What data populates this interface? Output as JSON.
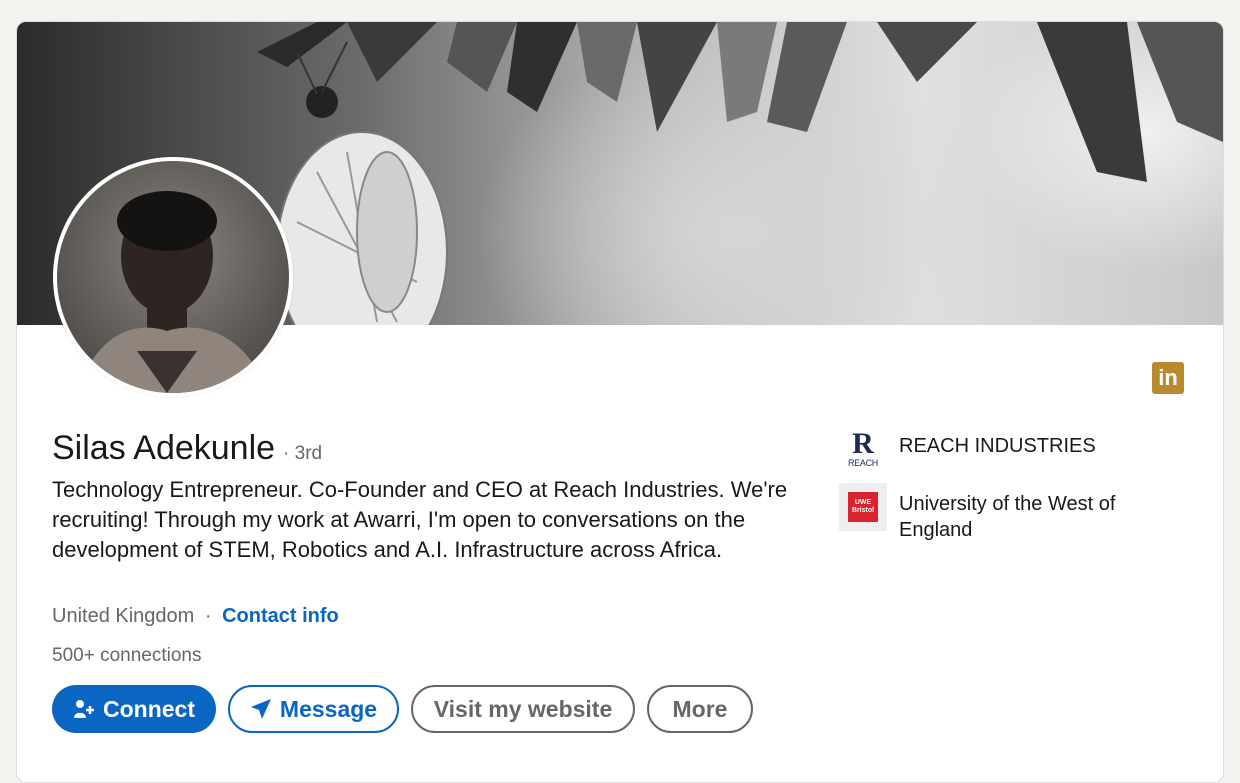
{
  "profile": {
    "name": "Silas Adekunle",
    "degree": "· 3rd",
    "headline": "Technology Entrepreneur. Co-Founder and CEO at Reach Industries. We're recruiting! Through my work at Awarri, I'm open to conversations on the development of STEM, Robotics and A.I. Infrastructure across Africa.",
    "location": "United Kingdom",
    "separator": "·",
    "contact_info": "Contact info",
    "connections": "500+ connections"
  },
  "actions": {
    "connect": "Connect",
    "message": "Message",
    "website": "Visit my website",
    "more": "More"
  },
  "sidebar": {
    "items": [
      {
        "label": "REACH INDUSTRIES",
        "logo_icon": "reach-logo",
        "logo_letter": "R",
        "logo_text": "REACH"
      },
      {
        "label": "University of the West of England",
        "logo_icon": "uwe-logo",
        "logo_text": "UWE Bristol"
      }
    ]
  },
  "badge": {
    "icon": "linkedin-icon",
    "text": "in"
  },
  "colors": {
    "primary": "#0a66c2",
    "badge": "#b9892f",
    "text": "#191919",
    "muted": "#666666"
  }
}
